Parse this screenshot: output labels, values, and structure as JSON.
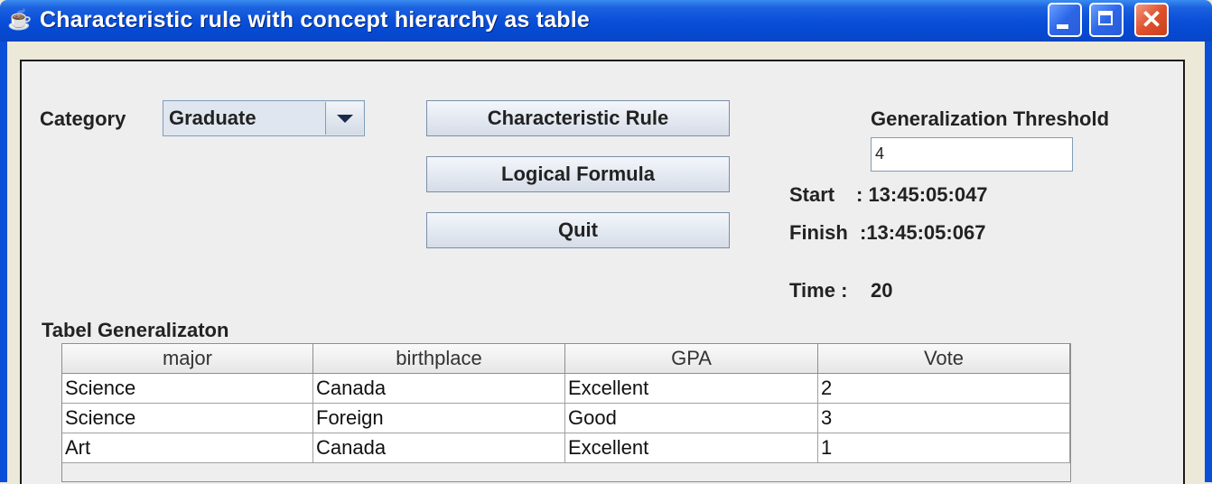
{
  "window": {
    "title": "Characteristic rule with concept hierarchy as table",
    "app_icon": "java-cup-icon",
    "controls": [
      "minimize-icon",
      "maximize-icon",
      "close-icon"
    ]
  },
  "form": {
    "category_label": "Category",
    "category_value": "Graduate",
    "buttons": {
      "characteristic_rule": "Characteristic Rule",
      "logical_formula": "Logical Formula",
      "quit": "Quit"
    },
    "threshold_label": "Generalization Threshold",
    "threshold_value": "4",
    "start_label": "Start",
    "start_value": ": 13:45:05:047",
    "finish_label": "Finish",
    "finish_value": ":13:45:05:067",
    "time_label": "Time :",
    "time_value": "20"
  },
  "table": {
    "title": "Tabel Generalizaton",
    "columns": [
      "major",
      "birthplace",
      "GPA",
      "Vote"
    ],
    "rows": [
      [
        "Science",
        "Canada",
        "Excellent",
        "2"
      ],
      [
        "Science",
        "Foreign",
        "Good",
        "3"
      ],
      [
        "Art",
        "Canada",
        "Excellent",
        "1"
      ]
    ]
  },
  "colors": {
    "titlebar": "#0a4fd8",
    "close_button": "#e0502c",
    "panel_bg": "#eeeeee"
  }
}
